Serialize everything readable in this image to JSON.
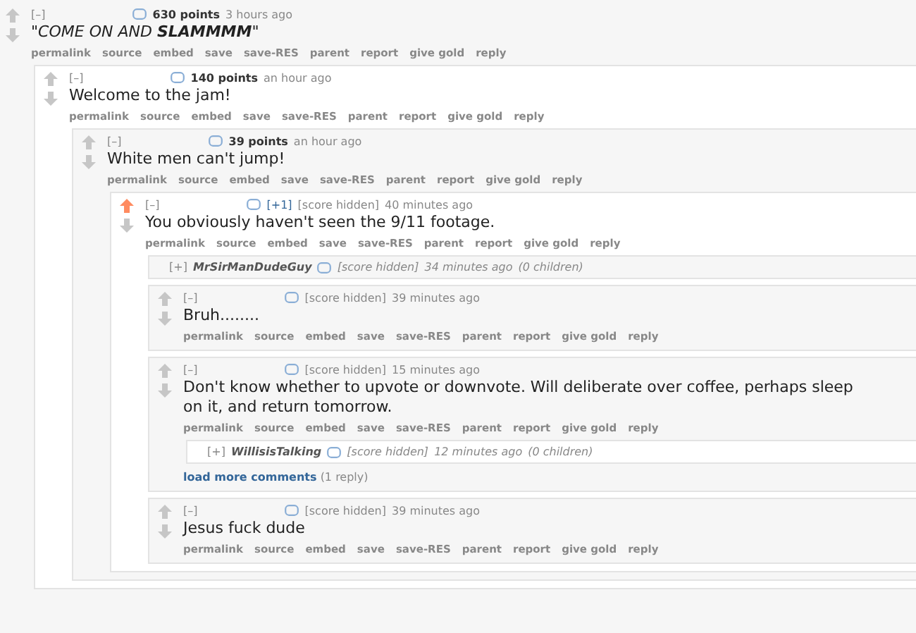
{
  "comments": [
    {
      "kind": "comment",
      "upvoted": false,
      "toggle": "[–]",
      "score": "630 points",
      "score_hidden": false,
      "time": "3 hours ago",
      "italic": true,
      "body": "\"COME ON AND **SLAMMMM**\"",
      "actions": [
        "permalink",
        "source",
        "embed",
        "save",
        "save-RES",
        "parent",
        "report",
        "give gold",
        "reply"
      ],
      "children": [
        {
          "kind": "comment",
          "upvoted": false,
          "toggle": "[–]",
          "score": "140 points",
          "score_hidden": false,
          "time": "an hour ago",
          "italic": false,
          "body": "Welcome to the jam!",
          "actions": [
            "permalink",
            "source",
            "embed",
            "save",
            "save-RES",
            "parent",
            "report",
            "give gold",
            "reply"
          ],
          "children": [
            {
              "kind": "comment",
              "upvoted": false,
              "toggle": "[–]",
              "score": "39 points",
              "score_hidden": false,
              "time": "an hour ago",
              "italic": false,
              "body": "White men can't jump!",
              "actions": [
                "permalink",
                "source",
                "embed",
                "save",
                "save-RES",
                "parent",
                "report",
                "give gold",
                "reply"
              ],
              "children": [
                {
                  "kind": "comment",
                  "upvoted": true,
                  "toggle": "[–]",
                  "flair": "[+1]",
                  "score": "[score hidden]",
                  "score_hidden": true,
                  "time": "40 minutes ago",
                  "italic": false,
                  "body": "You obviously haven't seen the 9/11 footage.",
                  "actions": [
                    "permalink",
                    "source",
                    "embed",
                    "save",
                    "save-RES",
                    "parent",
                    "report",
                    "give gold",
                    "reply"
                  ],
                  "children": [
                    {
                      "kind": "collapsed",
                      "toggle": "[+]",
                      "author": "MrSirManDudeGuy",
                      "score": "[score hidden]",
                      "time": "34 minutes ago",
                      "count": "(0 children)"
                    },
                    {
                      "kind": "comment",
                      "upvoted": false,
                      "toggle": "[–]",
                      "score": "[score hidden]",
                      "score_hidden": true,
                      "time": "39 minutes ago",
                      "italic": false,
                      "body": "Bruh........",
                      "actions": [
                        "permalink",
                        "source",
                        "embed",
                        "save",
                        "save-RES",
                        "parent",
                        "report",
                        "give gold",
                        "reply"
                      ]
                    },
                    {
                      "kind": "comment",
                      "upvoted": false,
                      "toggle": "[–]",
                      "score": "[score hidden]",
                      "score_hidden": true,
                      "time": "15 minutes ago",
                      "italic": false,
                      "body": "Don't know whether to upvote or downvote. Will deliberate over coffee, perhaps sleep on it, and return tomorrow.",
                      "actions": [
                        "permalink",
                        "source",
                        "embed",
                        "save",
                        "save-RES",
                        "parent",
                        "report",
                        "give gold",
                        "reply"
                      ],
                      "children": [
                        {
                          "kind": "collapsed",
                          "toggle": "[+]",
                          "author": "WillisisTalking",
                          "score": "[score hidden]",
                          "time": "12 minutes ago",
                          "count": "(0 children)"
                        },
                        {
                          "kind": "more",
                          "link": "load more comments",
                          "count": "(1 reply)"
                        }
                      ]
                    },
                    {
                      "kind": "comment",
                      "upvoted": false,
                      "toggle": "[–]",
                      "score": "[score hidden]",
                      "score_hidden": true,
                      "time": "39 minutes ago",
                      "italic": false,
                      "body": "Jesus fuck dude",
                      "actions": [
                        "permalink",
                        "source",
                        "embed",
                        "save",
                        "save-RES",
                        "parent",
                        "report",
                        "give gold",
                        "reply"
                      ]
                    }
                  ]
                }
              ]
            }
          ]
        }
      ]
    }
  ]
}
